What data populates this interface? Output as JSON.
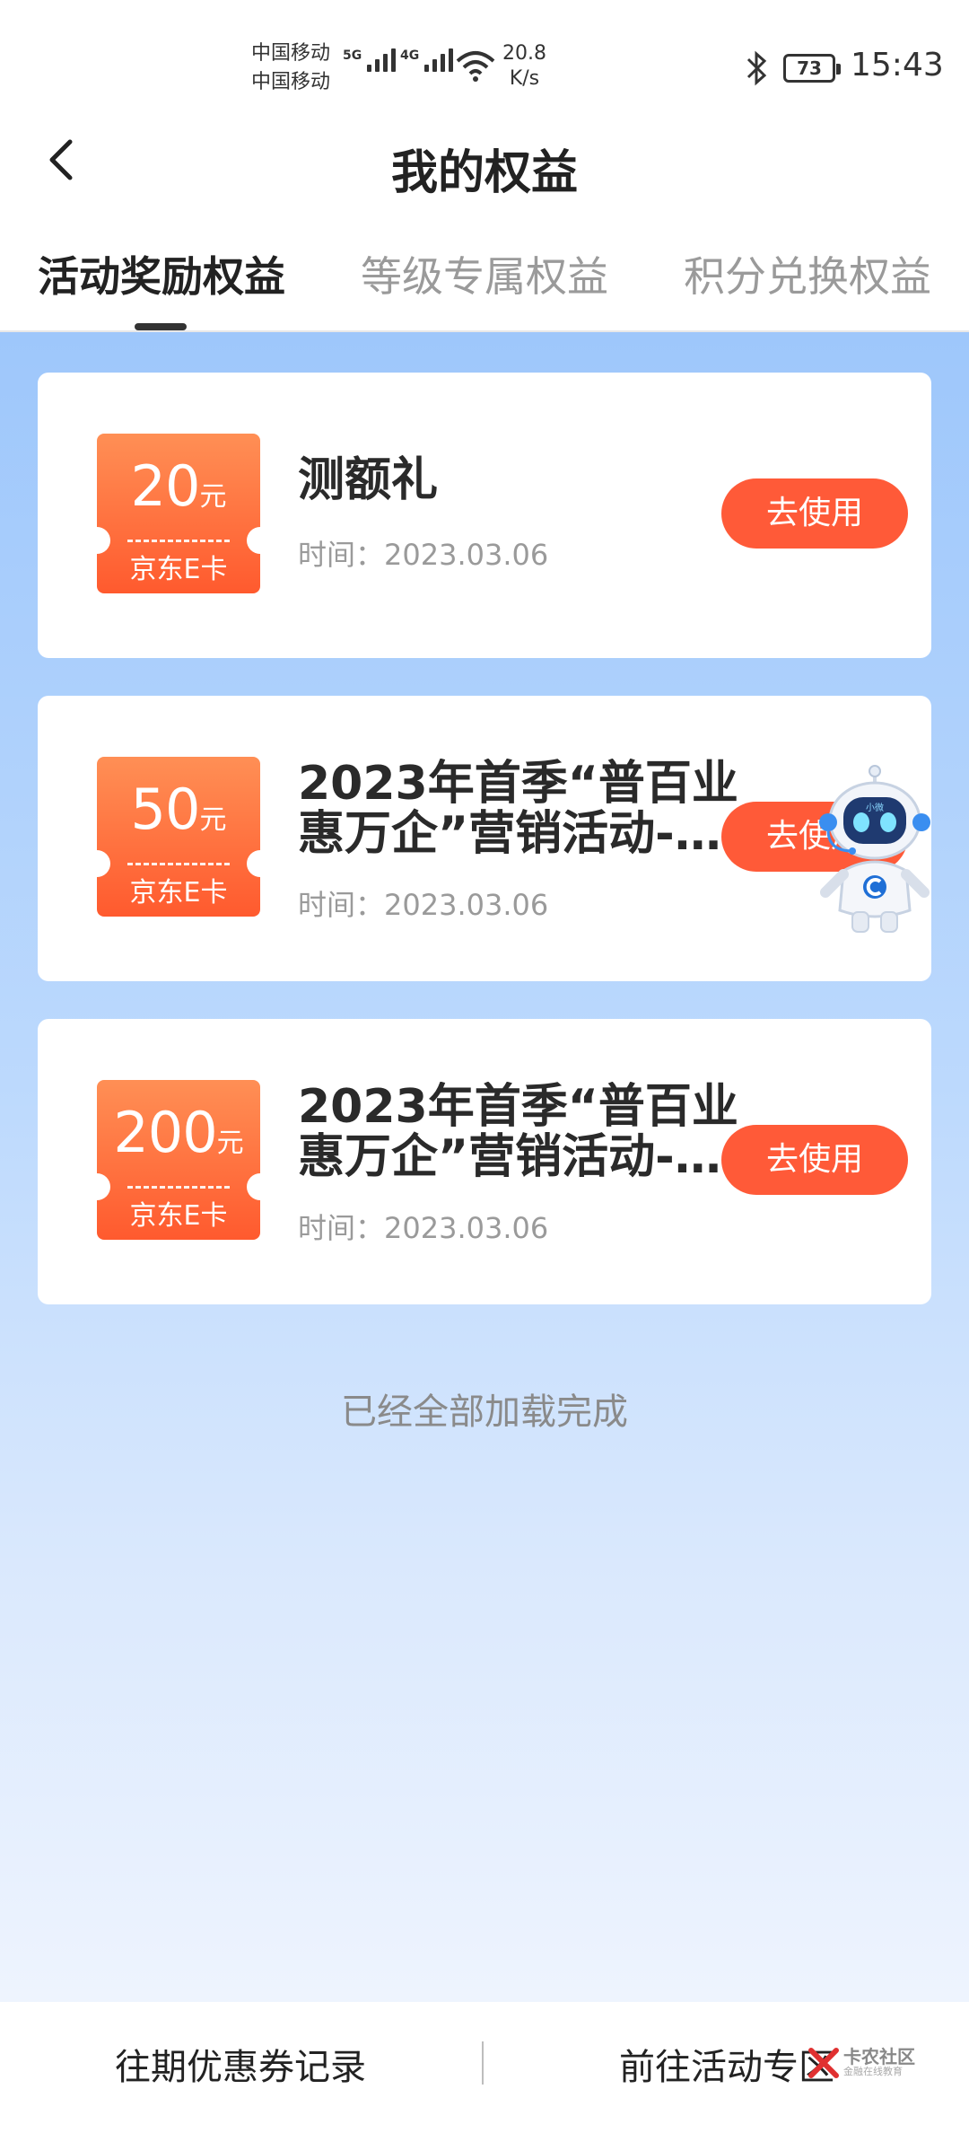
{
  "status_bar": {
    "carrier1": "中国移动",
    "carrier2": "中国移动",
    "net1": "5G",
    "net2": "4G",
    "speed_value": "20.8",
    "speed_unit": "K/s",
    "battery": "73",
    "time": "15:43"
  },
  "header": {
    "title": "我的权益"
  },
  "tabs": [
    {
      "label": "活动奖励权益",
      "active": true
    },
    {
      "label": "等级专属权益",
      "active": false
    },
    {
      "label": "积分兑换权益",
      "active": false
    }
  ],
  "cards": [
    {
      "amount": "20",
      "unit": "元",
      "kind": "京东E卡",
      "title": "测额礼",
      "date": "时间：2023.03.06",
      "button": "去使用"
    },
    {
      "amount": "50",
      "unit": "元",
      "kind": "京东E卡",
      "title": "2023年首季“普百业惠万企”营销活动-…",
      "date": "时间：2023.03.06",
      "button": "去使用"
    },
    {
      "amount": "200",
      "unit": "元",
      "kind": "京东E卡",
      "title": "2023年首季“普百业惠万企”营销活动-…",
      "date": "时间：2023.03.06",
      "button": "去使用"
    }
  ],
  "list_footer": "已经全部加载完成",
  "assistant": {
    "badge": "小微"
  },
  "bottom_bar": {
    "left": "往期优惠券记录",
    "right": "前往活动专区",
    "watermark": "卡农社区",
    "watermark_sub": "金融在线教育"
  },
  "colors": {
    "accent": "#ff5a38",
    "coupon_top": "#ff8f55",
    "coupon_bottom": "#ff5a2e",
    "bg_top": "#9ec7fb"
  }
}
